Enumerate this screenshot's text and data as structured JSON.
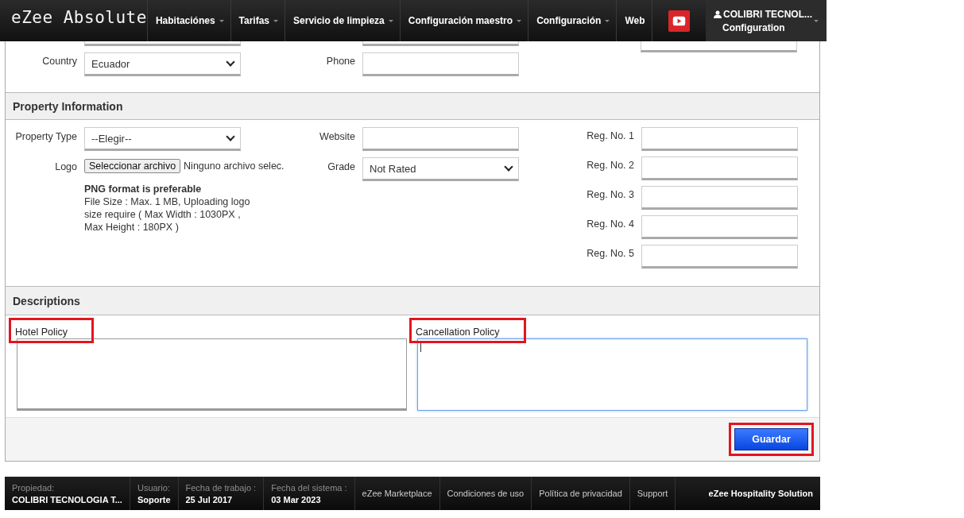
{
  "header": {
    "logo": "eZee Absolute",
    "nav": [
      {
        "label": "Habitaciónes",
        "dropdown": true
      },
      {
        "label": "Tarifas",
        "dropdown": true
      },
      {
        "label": "Servicio de limpieza",
        "dropdown": true
      },
      {
        "label": "Configuración maestro",
        "dropdown": true
      },
      {
        "label": "Configuración",
        "dropdown": true
      },
      {
        "label": "Web",
        "dropdown": false
      }
    ],
    "user": {
      "name": "COLIBRI TECNOL...",
      "role": "Configuration"
    }
  },
  "contact": {
    "country": {
      "label": "Country",
      "value": "Ecuador"
    },
    "phone": {
      "label": "Phone"
    }
  },
  "property_information": {
    "title": "Property Information",
    "property_type": {
      "label": "Property Type",
      "value": "--Elegir--"
    },
    "logo": {
      "label": "Logo",
      "button": "Seleccionar archivo",
      "file": "Ninguno archivo selec.",
      "hint_title": "PNG format is preferable",
      "hint": "File Size : Max. 1 MB, Uploading logo size require ( Max Width : 1030PX , Max Height : 180PX )"
    },
    "website": {
      "label": "Website"
    },
    "grade": {
      "label": "Grade",
      "value": "Not Rated"
    },
    "reg_numbers": [
      {
        "label": "Reg. No. 1"
      },
      {
        "label": "Reg. No. 2"
      },
      {
        "label": "Reg. No. 3"
      },
      {
        "label": "Reg. No. 4"
      },
      {
        "label": "Reg. No. 5"
      }
    ]
  },
  "descriptions": {
    "title": "Descriptions",
    "fields": [
      {
        "label": "Hotel Policy",
        "focused": false,
        "highlighted": true
      },
      {
        "label": "Cancellation Policy",
        "focused": true,
        "highlighted": true
      }
    ]
  },
  "save_button": {
    "label": "Guardar",
    "highlighted": true
  },
  "footer": {
    "info": [
      {
        "label": "Propiedad:",
        "value": "COLIBRI TECNOLOGIA T..."
      },
      {
        "label": "Usuario:",
        "value": "Soporte"
      },
      {
        "label": "Fecha de trabajo :",
        "value": "25 Jul 2017"
      },
      {
        "label": "Fecha del sistema :",
        "value": "03 Mar 2023"
      }
    ],
    "links": [
      "eZee Marketplace",
      "Condiciones de uso",
      "Política de privacidad",
      "Support"
    ],
    "brand": "eZee Hospitality Solution"
  }
}
